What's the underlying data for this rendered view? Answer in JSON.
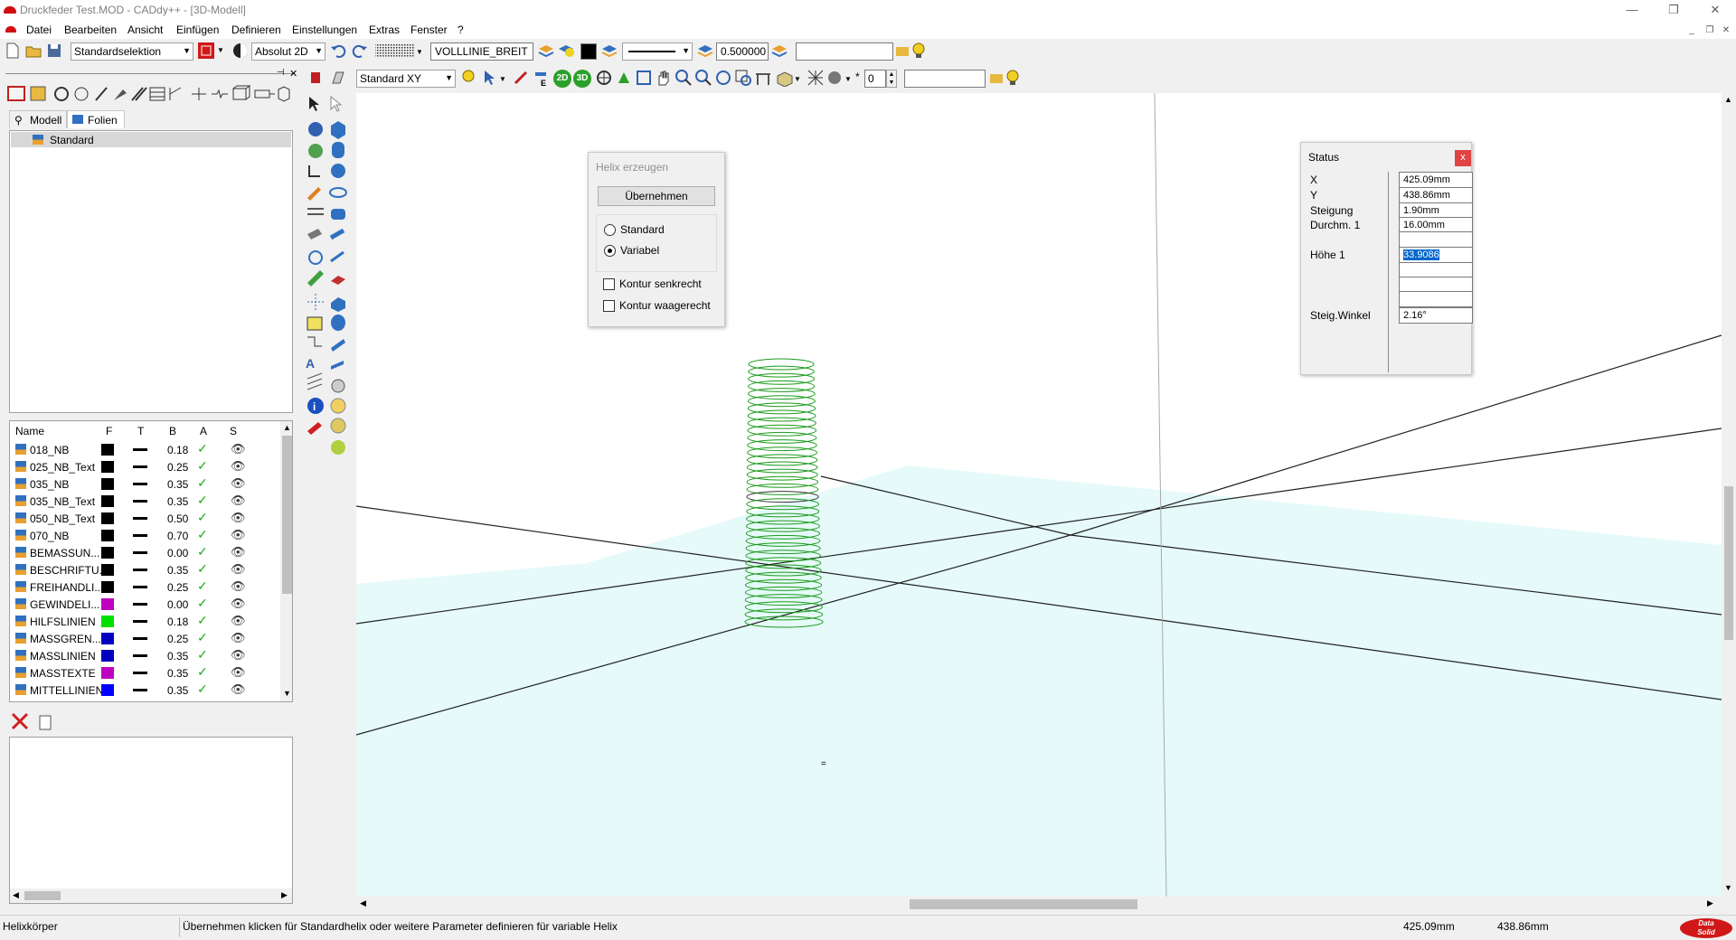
{
  "window": {
    "title": "Druckfeder Test.MOD  -  CADdy++ - [3D-Modell]",
    "min": "—",
    "restore": "❐",
    "close": "✕"
  },
  "menu": [
    "Datei",
    "Bearbeiten",
    "Ansicht",
    "Einfügen",
    "Definieren",
    "Einstellungen",
    "Extras",
    "Fenster",
    "?"
  ],
  "toolbar1": {
    "selection_mode": "Standardselektion",
    "coord_mode": "Absolut 2D",
    "linetype": "VOLLLINIE_BREIT",
    "linewidth": "0.500000",
    "input_value": ""
  },
  "toolbar2": {
    "view": "Standard XY",
    "btn_2d": "2D",
    "btn_3d": "3D",
    "spin_value": "0",
    "input_value": ""
  },
  "leftpanel": {
    "tabs": [
      "Modell",
      "Folien"
    ],
    "tree_item": "Standard",
    "columns": [
      "Name",
      "F",
      "T",
      "B",
      "A",
      "S"
    ],
    "layers": [
      {
        "name": "018_NB",
        "color": "#000000",
        "width": "0.18"
      },
      {
        "name": "025_NB_Text",
        "color": "#000000",
        "width": "0.25"
      },
      {
        "name": "035_NB",
        "color": "#000000",
        "width": "0.35"
      },
      {
        "name": "035_NB_Text",
        "color": "#000000",
        "width": "0.35"
      },
      {
        "name": "050_NB_Text",
        "color": "#000000",
        "width": "0.50"
      },
      {
        "name": "070_NB",
        "color": "#000000",
        "width": "0.70"
      },
      {
        "name": "BEMASSUN...",
        "color": "#000000",
        "width": "0.00"
      },
      {
        "name": "BESCHRIFTU...",
        "color": "#000000",
        "width": "0.35"
      },
      {
        "name": "FREIHANDLI...",
        "color": "#000000",
        "width": "0.25"
      },
      {
        "name": "GEWINDELI...",
        "color": "#c000c0",
        "width": "0.00"
      },
      {
        "name": "HILFSLINIEN",
        "color": "#00e000",
        "width": "0.18"
      },
      {
        "name": "MASSGREN...",
        "color": "#0000c0",
        "width": "0.25"
      },
      {
        "name": "MASSLINIEN",
        "color": "#0000c0",
        "width": "0.35"
      },
      {
        "name": "MASSTEXTE",
        "color": "#c000c0",
        "width": "0.35"
      },
      {
        "name": "MITTELLINIEN",
        "color": "#0000ff",
        "width": "0.35"
      }
    ]
  },
  "helix_dialog": {
    "title": "Helix erzeugen",
    "apply": "Übernehmen",
    "radio_standard": "Standard",
    "radio_variabel": "Variabel",
    "selected": "Variabel",
    "cb_senkrecht": "Kontur senkrecht",
    "cb_waagerecht": "Kontur waagerecht"
  },
  "status_dialog": {
    "title": "Status",
    "close": "x",
    "rows": [
      {
        "label": "X",
        "value": "425.09mm"
      },
      {
        "label": "Y",
        "value": "438.86mm"
      },
      {
        "label": "Steigung",
        "value": "1.90mm"
      },
      {
        "label": "Durchm. 1",
        "value": "16.00mm"
      },
      {
        "label": "",
        "value": ""
      },
      {
        "label": "Höhe 1",
        "value": "33.9086"
      },
      {
        "label": "",
        "value": ""
      },
      {
        "label": "",
        "value": ""
      },
      {
        "label": "",
        "value": ""
      },
      {
        "label": "Steig.Winkel",
        "value": "2.16°"
      }
    ]
  },
  "statusbar": {
    "mode": "Helixkörper",
    "hint": "Übernehmen klicken für Standardhelix oder weitere Parameter definieren für variable Helix",
    "x": "425.09mm",
    "y": "438.86mm",
    "logo": "Data Solid"
  },
  "colors": {
    "helix": "#1a9a1a",
    "plane": "#e6fafa",
    "accent": "#0066cc"
  }
}
